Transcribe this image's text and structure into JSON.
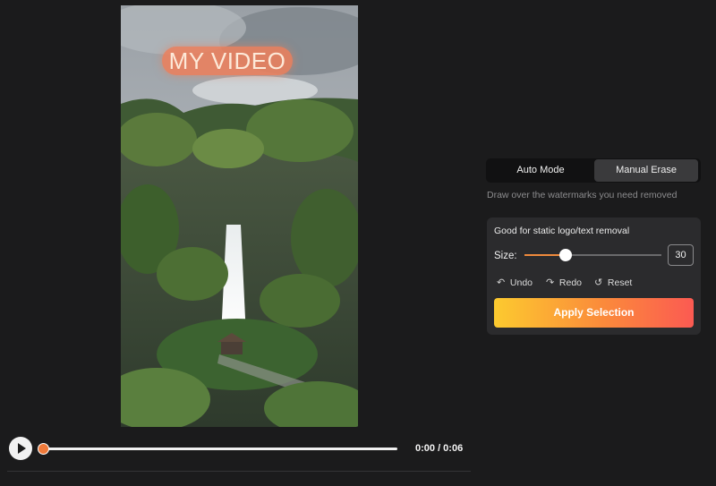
{
  "video": {
    "watermark_text": "MY VIDEO",
    "description_icon": "video-frame"
  },
  "player": {
    "play_icon": "play-icon",
    "time": "0:00 / 0:06",
    "progress_fraction": 0.0
  },
  "modes": {
    "auto_label": "Auto Mode",
    "manual_label": "Manual Erase",
    "active": "manual"
  },
  "hint": "Draw over the watermarks you need removed",
  "erase_panel": {
    "title": "Good for static logo/text removal",
    "size_label": "Size:",
    "size_value": "30",
    "size_min": 0,
    "size_max": 100,
    "undo_label": "Undo",
    "redo_label": "Redo",
    "reset_label": "Reset",
    "undo_icon": "undo-arrow-icon",
    "redo_icon": "redo-arrow-icon",
    "reset_icon": "reset-icon",
    "apply_label": "Apply Selection"
  },
  "colors": {
    "accent": "#ef8a3c",
    "apply_gradient_start": "#fcca2f",
    "apply_gradient_end": "#fb5a52",
    "background": "#1b1b1c",
    "panel": "#2b2b2d"
  }
}
